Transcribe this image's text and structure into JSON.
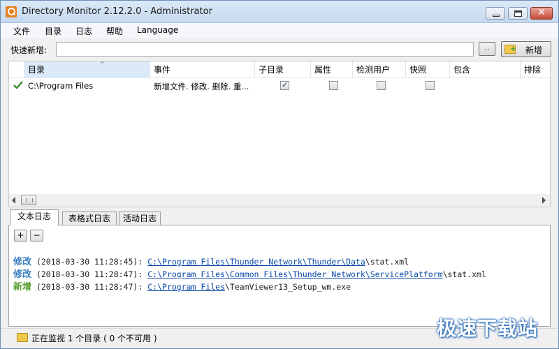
{
  "window": {
    "title": "Directory Monitor 2.12.2.0 - Administrator"
  },
  "menu": [
    "文件",
    "目录",
    "日志",
    "帮助",
    "Language"
  ],
  "quick_add": {
    "label": "快速新增:",
    "value": "",
    "placeholder": "",
    "browse_label": "..",
    "new_label": "新增"
  },
  "list": {
    "columns": [
      "目录",
      "事件",
      "子目录",
      "属性",
      "检测用户",
      "快照",
      "包含",
      "排除"
    ],
    "sorted_column": "目录",
    "rows": [
      {
        "status": "check-icon",
        "directory": "C:\\Program Files",
        "events": "新增文件. 修改. 删除. 重...",
        "subdirs": true,
        "attributes": false,
        "detect_user": false,
        "snapshot": false
      }
    ]
  },
  "tabs": [
    "文本日志",
    "表格式日志",
    "活动日志"
  ],
  "active_tab": "文本日志",
  "log_controls": {
    "plus": "+",
    "minus": "−"
  },
  "log": [
    {
      "action": "修改",
      "time": "(2018-03-30 11:28:45):",
      "path_link": "C:\\Program Files\\Thunder Network\\Thunder\\Data",
      "file": "\\stat.xml",
      "color": "#3a7fc1"
    },
    {
      "action": "修改",
      "time": "(2018-03-30 11:28:47):",
      "path_link": "C:\\Program Files\\Common Files\\Thunder Network\\ServicePlatform",
      "file": "\\stat.xml",
      "color": "#3a7fc1"
    },
    {
      "action": "新增",
      "time": "(2018-03-30 11:28:47):",
      "path_link": "C:\\Program Files",
      "file": "\\TeamViewer13_Setup_wm.exe",
      "color": "#5a9e2f"
    }
  ],
  "status": {
    "text": "正在监视 1 个目录 ( 0 个不可用 )"
  },
  "watermark": "极速下载站"
}
